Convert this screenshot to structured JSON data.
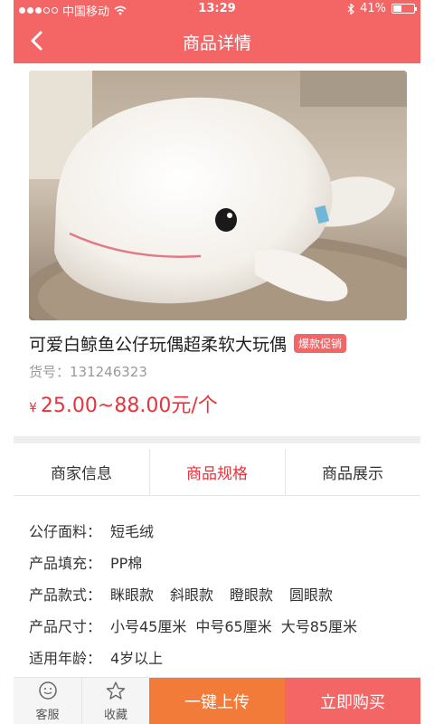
{
  "status_bar": {
    "carrier": "中国移动",
    "time": "13:29",
    "battery": "41%",
    "battery_level": 0.41,
    "signal_icon": "signal-dots-icon",
    "wifi_icon": "wifi-icon",
    "bluetooth_icon": "bluetooth-icon"
  },
  "nav": {
    "title": "商品详情",
    "back_icon": "chevron-left-icon"
  },
  "product": {
    "title": "可爱白鲸鱼公仔玩偶超柔软大玩偶",
    "badge": "爆款促销",
    "sku": "货号：131246323",
    "currency": "¥",
    "price": "25.00~88.00元/个"
  },
  "tabs": [
    {
      "label": "商家信息",
      "active": false
    },
    {
      "label": "商品规格",
      "active": true
    },
    {
      "label": "商品展示",
      "active": false
    }
  ],
  "specs": [
    {
      "label": "公仔面料：",
      "values": [
        "短毛绒"
      ]
    },
    {
      "label": "产品填充：",
      "values": [
        "PP棉"
      ]
    },
    {
      "label": "产品款式：",
      "values": [
        "眯眼款",
        "斜眼款",
        "瞪眼款",
        "圆眼款"
      ]
    },
    {
      "label": "产品尺寸：",
      "values": [
        "小号45厘米",
        "中号65厘米",
        "大号85厘米"
      ]
    },
    {
      "label": "适用年龄：",
      "values": [
        "4岁以上"
      ]
    }
  ],
  "bottom_bar": {
    "service_label": "客服",
    "favorite_label": "收藏",
    "upload_label": "一键上传",
    "buy_label": "立即购买"
  },
  "colors": {
    "brand": "#f46565",
    "price": "#e8333b",
    "upload": "#f27b3a"
  }
}
